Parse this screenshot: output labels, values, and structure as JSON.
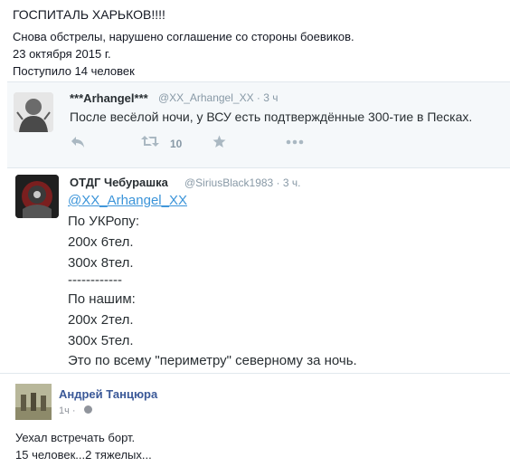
{
  "post": {
    "title": "ГОСПИТАЛЬ ХАРЬКОВ!!!!",
    "lines": [
      "Снова обстрелы, нарушено соглашение со стороны боевиков.",
      "23 октября 2015 г.",
      "Поступило 14 человек"
    ]
  },
  "tweet1": {
    "name": "***Arhangel***",
    "handle_time": "@XX_Arhangel_XX · 3 ч",
    "text": "После весёлой ночи, у ВСУ есть подтверждённые 300-тие в Песках.",
    "retweet_count": "10",
    "icons": [
      "reply-icon",
      "retweet-icon",
      "favorite-icon",
      "more-icon"
    ]
  },
  "tweet2": {
    "name": "ОТДГ Чебурашка",
    "handle_time": "@SiriusBlack1983 · 3 ч.",
    "mention": "@XX_Arhangel_XX",
    "lines": [
      "По УКРопу:",
      "200х 6тел.",
      "300х 8тел.",
      "------------",
      "По нашим:",
      "200х 2тел.",
      "300х 5тел.",
      "Это по всему \"периметру\" северному за ночь."
    ]
  },
  "comment": {
    "name": "Андрей Танцюра",
    "time": "1ч ·",
    "lines": [
      "Уехал встречать борт.",
      "15 человек...2 тяжелых..."
    ]
  },
  "colors": {
    "link": "#3b94d9",
    "fb_name": "#3b5998",
    "muted": "#8899a6",
    "tweet_bg": "#f5f8fa"
  }
}
